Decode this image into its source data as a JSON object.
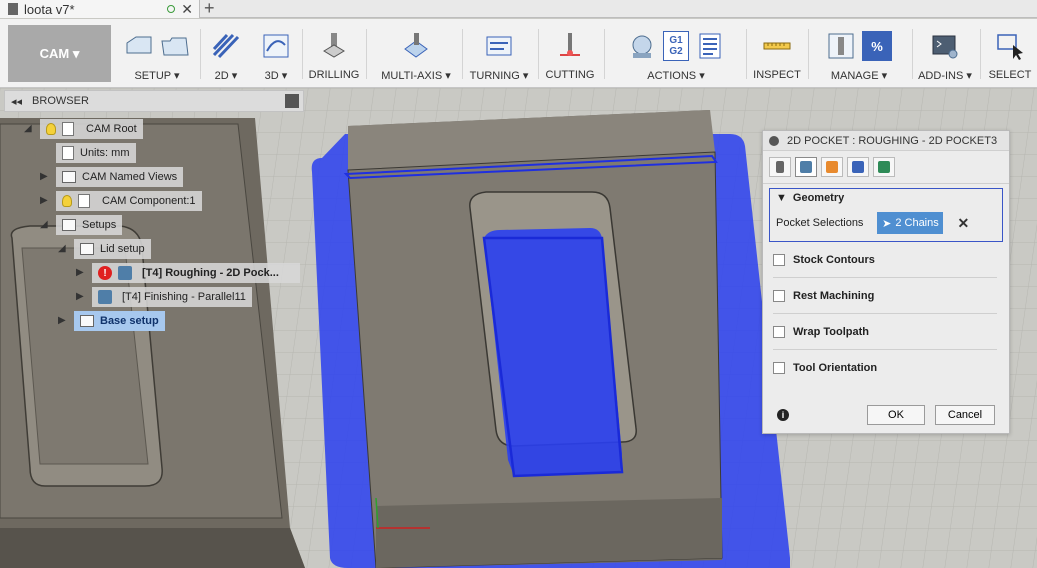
{
  "document": {
    "title": "loota v7*"
  },
  "toolbar": {
    "workspace": "CAM ▾",
    "groups": [
      {
        "label": "SETUP ▾"
      },
      {
        "label": "2D ▾"
      },
      {
        "label": "3D ▾"
      },
      {
        "label": "DRILLING"
      },
      {
        "label": "MULTI-AXIS ▾"
      },
      {
        "label": "TURNING ▾"
      },
      {
        "label": "CUTTING"
      },
      {
        "label": "ACTIONS ▾"
      },
      {
        "label": "INSPECT"
      },
      {
        "label": "MANAGE ▾"
      },
      {
        "label": "ADD-INS ▾"
      },
      {
        "label": "SELECT"
      }
    ],
    "actions_icon_text": "G1\nG2"
  },
  "browser": {
    "title": "BROWSER",
    "nodes": [
      {
        "label": "CAM Root"
      },
      {
        "label": "Units: mm"
      },
      {
        "label": "CAM Named Views"
      },
      {
        "label": "CAM Component:1"
      },
      {
        "label": "Setups"
      },
      {
        "label": "Lid setup"
      },
      {
        "label": "[T4] Roughing - 2D Pock..."
      },
      {
        "label": "[T4] Finishing - Parallel11"
      },
      {
        "label": "Base setup"
      }
    ]
  },
  "panel": {
    "title": "2D POCKET : ROUGHING - 2D POCKET3",
    "geometry_label": "Geometry",
    "pocket_selections_label": "Pocket Selections",
    "chains_value": "2 Chains",
    "options": [
      "Stock Contours",
      "Rest Machining",
      "Wrap Toolpath",
      "Tool Orientation"
    ],
    "ok": "OK",
    "cancel": "Cancel"
  },
  "colors": {
    "accent": "#3a55c7",
    "selection_fill": "#2a3ff0",
    "chains_button": "#4f8fd1"
  }
}
